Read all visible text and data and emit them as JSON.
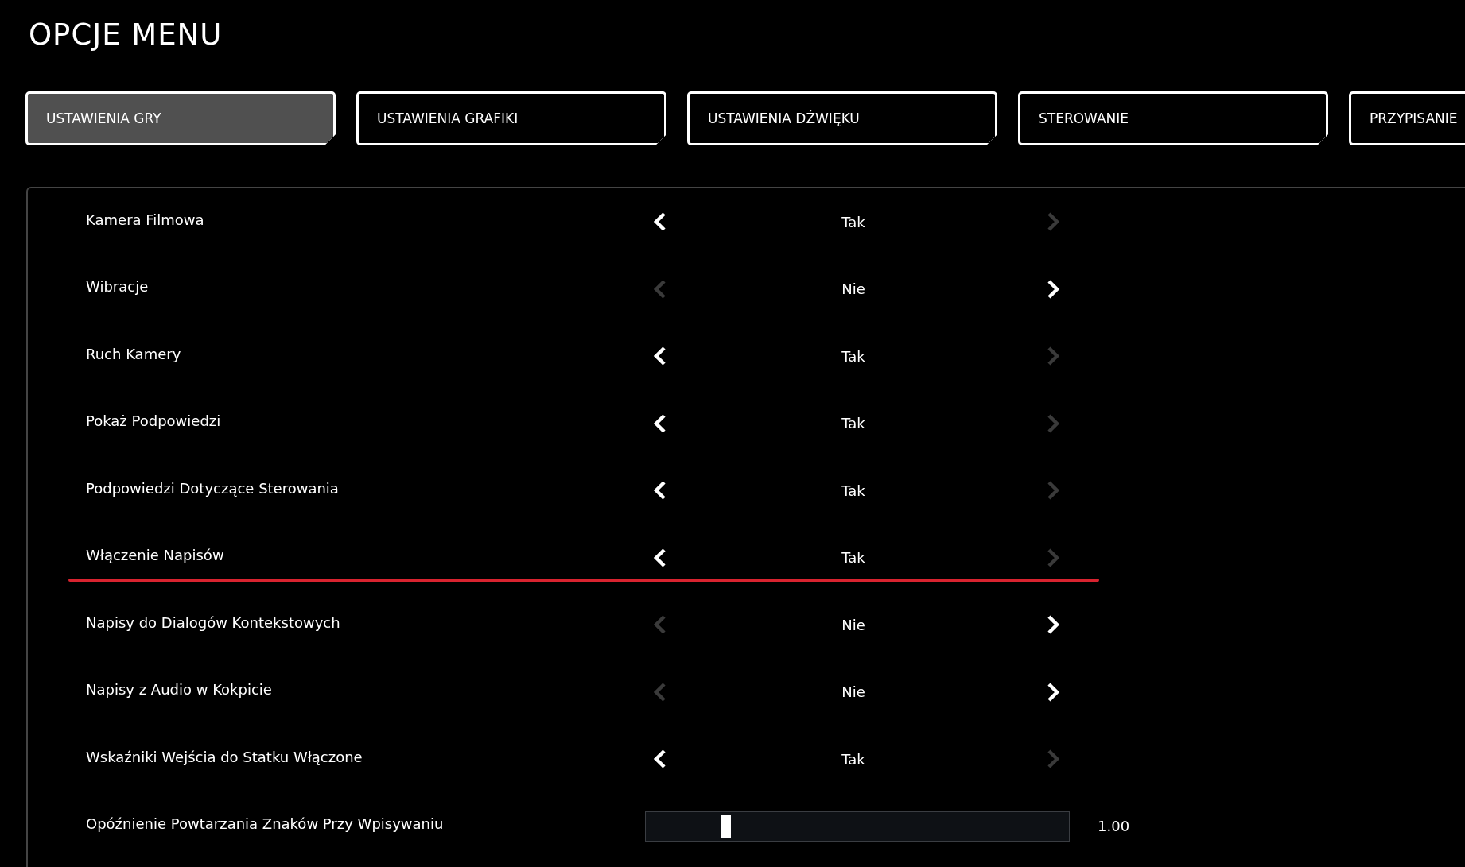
{
  "title": "OPCJE MENU",
  "tabs": [
    {
      "label": "USTAWIENIA GRY",
      "selected": true
    },
    {
      "label": "USTAWIENIA GRAFIKI",
      "selected": false
    },
    {
      "label": "USTAWIENIA DŹWIĘKU",
      "selected": false
    },
    {
      "label": "STEROWANIE",
      "selected": false
    },
    {
      "label": "PRZYPISANIE",
      "selected": false
    }
  ],
  "settings": [
    {
      "kind": "choice",
      "label": "Kamera Filmowa",
      "value": "Tak",
      "left_arrow_enabled": true,
      "right_arrow_enabled": false,
      "selected": false
    },
    {
      "kind": "choice",
      "label": "Wibracje",
      "value": "Nie",
      "left_arrow_enabled": false,
      "right_arrow_enabled": true,
      "selected": false
    },
    {
      "kind": "choice",
      "label": "Ruch Kamery",
      "value": "Tak",
      "left_arrow_enabled": true,
      "right_arrow_enabled": false,
      "selected": false
    },
    {
      "kind": "choice",
      "label": "Pokaż Podpowiedzi",
      "value": "Tak",
      "left_arrow_enabled": true,
      "right_arrow_enabled": false,
      "selected": false
    },
    {
      "kind": "choice",
      "label": "Podpowiedzi Dotyczące Sterowania",
      "value": "Tak",
      "left_arrow_enabled": true,
      "right_arrow_enabled": false,
      "selected": false
    },
    {
      "kind": "choice",
      "label": "Włączenie Napisów",
      "value": "Tak",
      "left_arrow_enabled": true,
      "right_arrow_enabled": false,
      "selected": true
    },
    {
      "kind": "choice",
      "label": "Napisy do Dialogów Kontekstowych",
      "value": "Nie",
      "left_arrow_enabled": false,
      "right_arrow_enabled": true,
      "selected": false
    },
    {
      "kind": "choice",
      "label": "Napisy z Audio w Kokpicie",
      "value": "Nie",
      "left_arrow_enabled": false,
      "right_arrow_enabled": true,
      "selected": false
    },
    {
      "kind": "choice",
      "label": "Wskaźniki Wejścia do Statku Włączone",
      "value": "Tak",
      "left_arrow_enabled": true,
      "right_arrow_enabled": false,
      "selected": false
    },
    {
      "kind": "slider",
      "label": "Opóźnienie Powtarzania Znaków Przy Wpisywaniu",
      "level": 0.19,
      "reading": "1.00",
      "selected": false
    }
  ]
}
